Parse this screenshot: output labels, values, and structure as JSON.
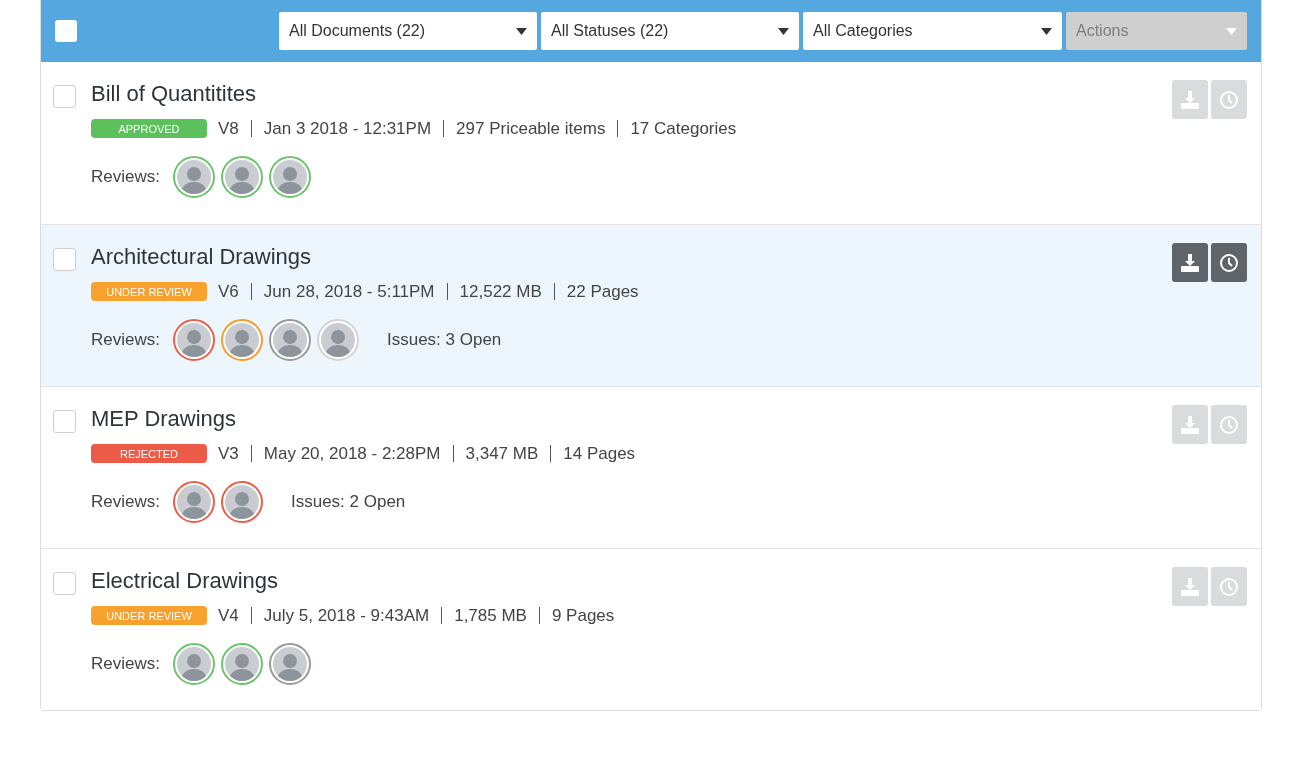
{
  "header": {
    "select_all_checked": false,
    "filters": [
      {
        "label": "All Documents (22)",
        "disabled": false
      },
      {
        "label": "All Statuses (22)",
        "disabled": false
      },
      {
        "label": "All Categories",
        "disabled": false
      },
      {
        "label": "Actions",
        "disabled": true
      }
    ]
  },
  "documents": [
    {
      "title": "Bill of Quantitites",
      "checked": false,
      "highlighted": false,
      "status": {
        "kind": "approved",
        "label": "APPROVED"
      },
      "meta": [
        "V8",
        "Jan 3 2018 - 12:31PM",
        "297 Priceable items",
        "17 Categories"
      ],
      "reviews_label": "Reviews:",
      "reviewers": [
        {
          "color": "#6cc56c"
        },
        {
          "color": "#6cc56c"
        },
        {
          "color": "#6cc56c"
        }
      ]
    },
    {
      "title": "Architectural Drawings",
      "checked": false,
      "highlighted": true,
      "status": {
        "kind": "under_review",
        "label": "UNDER REVIEW"
      },
      "meta": [
        "V6",
        "Jun 28, 2018 - 5:11PM",
        "12,522 MB",
        "22 Pages"
      ],
      "reviews_label": "Reviews:",
      "reviewers": [
        {
          "color": "#e8604a"
        },
        {
          "color": "#f59e2a"
        },
        {
          "color": "#9a9a9a"
        },
        {
          "color": "#d4d4d4"
        }
      ],
      "issues": "Issues: 3 Open"
    },
    {
      "title": "MEP Drawings",
      "checked": false,
      "highlighted": false,
      "status": {
        "kind": "rejected",
        "label": "REJECTED"
      },
      "meta": [
        "V3",
        "May 20, 2018 - 2:28PM",
        "3,347 MB",
        "14 Pages"
      ],
      "reviews_label": "Reviews:",
      "reviewers": [
        {
          "color": "#e8604a"
        },
        {
          "color": "#e8604a"
        }
      ],
      "issues": "Issues: 2 Open"
    },
    {
      "title": "Electrical Drawings",
      "checked": false,
      "highlighted": false,
      "status": {
        "kind": "under_review",
        "label": "UNDER REVIEW"
      },
      "meta": [
        "V4",
        "July 5, 2018 - 9:43AM",
        "1,785 MB",
        "9 Pages"
      ],
      "reviews_label": "Reviews:",
      "reviewers": [
        {
          "color": "#6cc56c"
        },
        {
          "color": "#6cc56c"
        },
        {
          "color": "#9a9a9a"
        }
      ]
    }
  ]
}
